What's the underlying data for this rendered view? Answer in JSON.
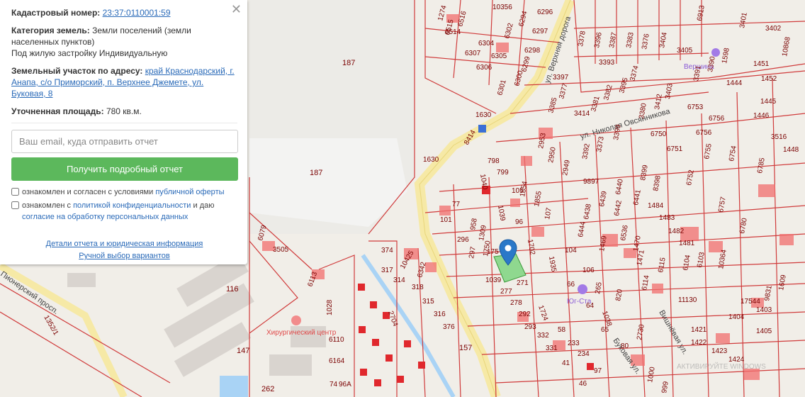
{
  "panel": {
    "close": "✕",
    "cadastral_label": "Кадастровый номер:",
    "cadastral_value": "23:37:0110001:59",
    "category_label": "Категория земель:",
    "category_value": "Земли поселений (земли населенных пунктов)",
    "usage": "Под жилую застройку Индивидуальную",
    "address_label": "Земельный участок по адресу:",
    "address_value": "край Краснодарский, г. Анапа, с/о Приморский, п. Верхнее Джемете, ул. Буковая, 8",
    "area_label": "Уточненная площадь:",
    "area_value": "780 кв.м.",
    "email_placeholder": "Ваш email, куда отправить отчет",
    "submit_label": "Получить подробный отчет",
    "check1_text": "ознакомлен и согласен с условиями",
    "check1_link": "публичной оферты",
    "check2_text1": "ознакомлен с",
    "check2_link1": "политикой конфиденциальности",
    "check2_text2": "и даю",
    "check2_link2": "согласие на обработку персональных данных",
    "details_link": "Детали отчета и юридическая информация",
    "manual_link": "Ручной выбор вариантов"
  },
  "map": {
    "streets": {
      "verhnyaya": "ул. Верхняя дорога",
      "ovsyannikova": "ул. Николая Овсянникова",
      "bukovaya": "Буковая ул.",
      "pionersky": "Пионерский просп.",
      "sosnovaya": "Вишнёвая ул.",
      "vishnevaya": "ул. Буковая"
    },
    "pois": {
      "hospital": "Хирургический центр",
      "yug": "Юг-Ста",
      "vershina": "Вершина",
      "watermark": "АКТИВИРУЙТЕ WINDOWS"
    },
    "parcels": {
      "p187a": "187",
      "p187b": "187",
      "p116": "116",
      "p147": "147",
      "p262": "262",
      "p3505": "3505",
      "p6079": "6079",
      "p6113": "6113",
      "p1352": "1352/1",
      "p1630a": "1630",
      "p1630b": "1630",
      "p8414": "8414",
      "p1028": "1028",
      "p6110": "6110",
      "p6164": "6164",
      "p74": "74",
      "p96a": "96А",
      "p374": "374",
      "p317": "317",
      "p10425": "10425",
      "p314": "314",
      "p6342": "6342",
      "p318": "318",
      "p315": "315",
      "p316": "316",
      "p376": "376",
      "p157": "157",
      "p2704": "2704",
      "p101": "101",
      "p77": "77",
      "p296": "296",
      "p958": "958",
      "p1309": "1309",
      "p297": "297",
      "p1750": "1750",
      "p175": "175",
      "p1039a": "1039",
      "p1039b": "1039",
      "p277": "277",
      "p271": "271",
      "p278": "278",
      "p292": "292",
      "p293": "293",
      "p1724": "1724",
      "p332": "332",
      "p58": "58",
      "p331": "331",
      "p233": "233",
      "p234": "234",
      "p41": "41",
      "p46": "46",
      "p97": "97",
      "p798": "798",
      "p799": "799",
      "p1040": "1040",
      "p105": "105",
      "p1854": "1854",
      "p96": "96",
      "p1855": "1855",
      "p107": "107",
      "p1702": "1702",
      "p1935": "1935",
      "p104": "104",
      "p106": "106",
      "p66": "66",
      "p64": "64",
      "p265": "265",
      "p820": "820",
      "p1038": "1038",
      "p65": "65",
      "p80": "80",
      "p2730": "2730",
      "p2953": "2953",
      "p2950": "2950",
      "p2949": "2949",
      "p9897": "9897",
      "p6438": "6438",
      "p6439": "6439",
      "p6440": "6440",
      "p6441": "6441",
      "p6442": "6442",
      "p6444": "6444",
      "p1469": "1469",
      "p6536": "6536",
      "p1470": "1470",
      "p1471": "1471",
      "p6114": "6114",
      "p6115": "6115",
      "p8399": "8399",
      "p8398": "8398",
      "p1484": "1484",
      "p1483": "1483",
      "p1482": "1482",
      "p1481": "1481",
      "p6104": "6104",
      "p6103": "6103",
      "p10364": "10364",
      "p11130": "11130",
      "p17544": "17544",
      "p1403": "1403",
      "p1404": "1404",
      "p1405": "1405",
      "p1421": "1421",
      "p1422": "1422",
      "p1423": "1423",
      "p1424": "1424",
      "p1000": "1000",
      "p999": "999",
      "p6750": "6750",
      "p6751": "6751",
      "p6752": "6752",
      "p6753": "6753",
      "p6754": "6754",
      "p6755": "6755",
      "p6756a": "6756",
      "p6756b": "6756",
      "p6757": "6757",
      "p6785": "6785",
      "p6780": "6780",
      "p1444": "1444",
      "p1445": "1445",
      "p1446": "1446",
      "p1448": "1448",
      "p1452": "1452",
      "p3516": "3516",
      "p1609": "1609",
      "p9831": "9831",
      "p1446b": "1446",
      "p1274": "1274",
      "p6516": "6516",
      "p6515": "6515",
      "p6514": "6514",
      "p10356": "10356",
      "p6302": "6302",
      "p6304": "6304",
      "p6307": "6307",
      "p6305": "6305",
      "p6306": "6306",
      "p6301": "6301",
      "p6300": "6300",
      "p6299": "6299",
      "p6298": "6298",
      "p6297": "6297",
      "p6296": "6296",
      "p6294": "6294",
      "p3378": "3378",
      "p3396": "3396",
      "p3387": "3387",
      "p3383": "3383",
      "p3376": "3376",
      "p3404": "3404",
      "p3405": "3405",
      "p3393": "3393",
      "p3397": "3397",
      "p3377": "3377",
      "p3385": "3385",
      "p3414": "3414",
      "p3381": "3381",
      "p3382": "3382",
      "p3395": "3395",
      "p3374": "3374",
      "p3399": "3399",
      "p3373": "3373",
      "p3392": "3392",
      "p3380": "3380",
      "p3412": "3412",
      "p3403": "3403",
      "p3391": "3391",
      "p3390": "3390",
      "p1598": "1598",
      "p3402": "3402",
      "p3401": "3401",
      "p6913": "6913",
      "p10868": "10868",
      "p1451": "1451"
    }
  }
}
